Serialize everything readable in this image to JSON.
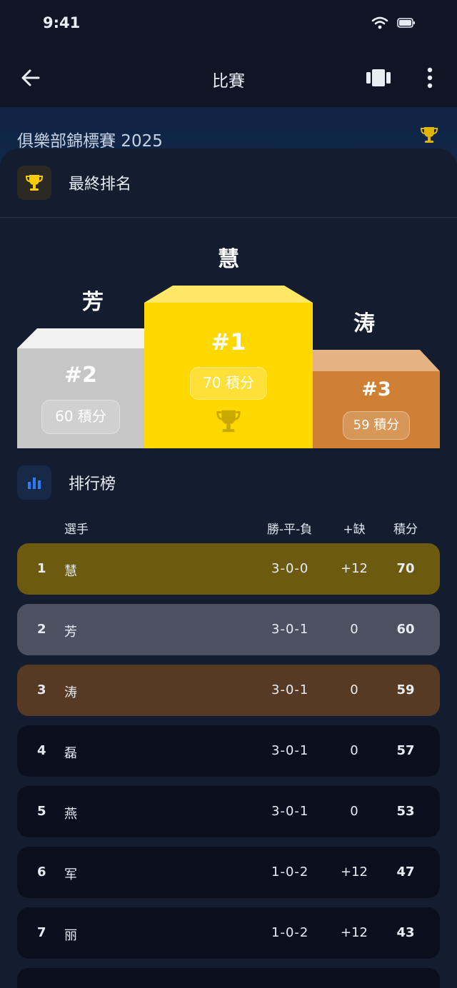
{
  "status_bar": {
    "time": "9:41"
  },
  "app_bar": {
    "title": "比賽"
  },
  "tournament": {
    "name": "俱樂部錦標賽 2025"
  },
  "final_ranking": {
    "section_title": "最終排名",
    "first": {
      "name": "慧",
      "rank": "#1",
      "points": "70 積分"
    },
    "second": {
      "name": "芳",
      "rank": "#2",
      "points": "60 積分"
    },
    "third": {
      "name": "涛",
      "rank": "#3",
      "points": "59 積分"
    }
  },
  "leaderboard": {
    "section_title": "排行榜",
    "columns": {
      "player": "選手",
      "record": "勝-平-負",
      "diff": "+缺",
      "points": "積分"
    },
    "rows": [
      {
        "rank": "1",
        "name": "慧",
        "record": "3-0-0",
        "diff": "+12",
        "points": "70"
      },
      {
        "rank": "2",
        "name": "芳",
        "record": "3-0-1",
        "diff": "0",
        "points": "60"
      },
      {
        "rank": "3",
        "name": "涛",
        "record": "3-0-1",
        "diff": "0",
        "points": "59"
      },
      {
        "rank": "4",
        "name": "磊",
        "record": "3-0-1",
        "diff": "0",
        "points": "57"
      },
      {
        "rank": "5",
        "name": "燕",
        "record": "3-0-1",
        "diff": "0",
        "points": "53"
      },
      {
        "rank": "6",
        "name": "军",
        "record": "1-0-2",
        "diff": "+12",
        "points": "47"
      },
      {
        "rank": "7",
        "name": "丽",
        "record": "1-0-2",
        "diff": "+12",
        "points": "43"
      }
    ]
  },
  "colors": {
    "gold": "#ffd800",
    "silver": "#c6c6c6",
    "bronze": "#cf8034",
    "row_gold": "#6b5a10",
    "row_silver": "#4b5160",
    "row_bronze": "#563a24",
    "row_default": "#0a0f1e"
  },
  "icons": {
    "back": "arrow-left-icon",
    "view": "carousel-icon",
    "more": "more-vertical-icon",
    "trophy": "trophy-icon",
    "chart": "bar-chart-icon"
  }
}
